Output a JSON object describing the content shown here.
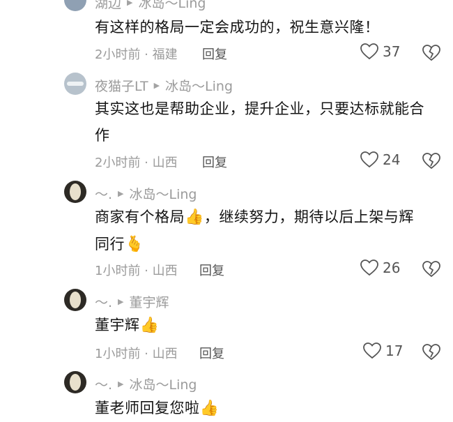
{
  "comments": [
    {
      "author": "湖边",
      "reply_to": "冰岛～Ling",
      "text": "有这样的格局一定会成功的，祝生意兴隆！",
      "time_location": "2小时前 · 福建",
      "reply_label": "回复",
      "likes": "37"
    },
    {
      "author": "夜猫子LT",
      "reply_to": "冰岛～Ling",
      "text_line1": "其实这也是帮助企业，提升企业，只要达标就能合",
      "text_line2": "作",
      "time_location": "2小时前 · 山西",
      "reply_label": "回复",
      "likes": "24"
    },
    {
      "author": "～.",
      "reply_to": "冰岛～Ling",
      "text_line1_a": "商家有个格局",
      "text_line1_b": "，继续努力，期待以后上架与辉",
      "text_line2": "同行",
      "time_location": "1小时前 · 山西",
      "reply_label": "回复",
      "likes": "26"
    },
    {
      "author": "～.",
      "reply_to": "董宇辉",
      "text": "董宇辉",
      "time_location": "1小时前 · 山西",
      "reply_label": "回复",
      "likes": "17"
    },
    {
      "author": "～.",
      "reply_to": "冰岛～Ling",
      "text": "董老师回复您啦"
    }
  ],
  "icons": {
    "thumbs_up": "👍",
    "heart_hands": "🫰",
    "like": "heart-outline-icon",
    "dislike": "broken-heart-icon"
  }
}
